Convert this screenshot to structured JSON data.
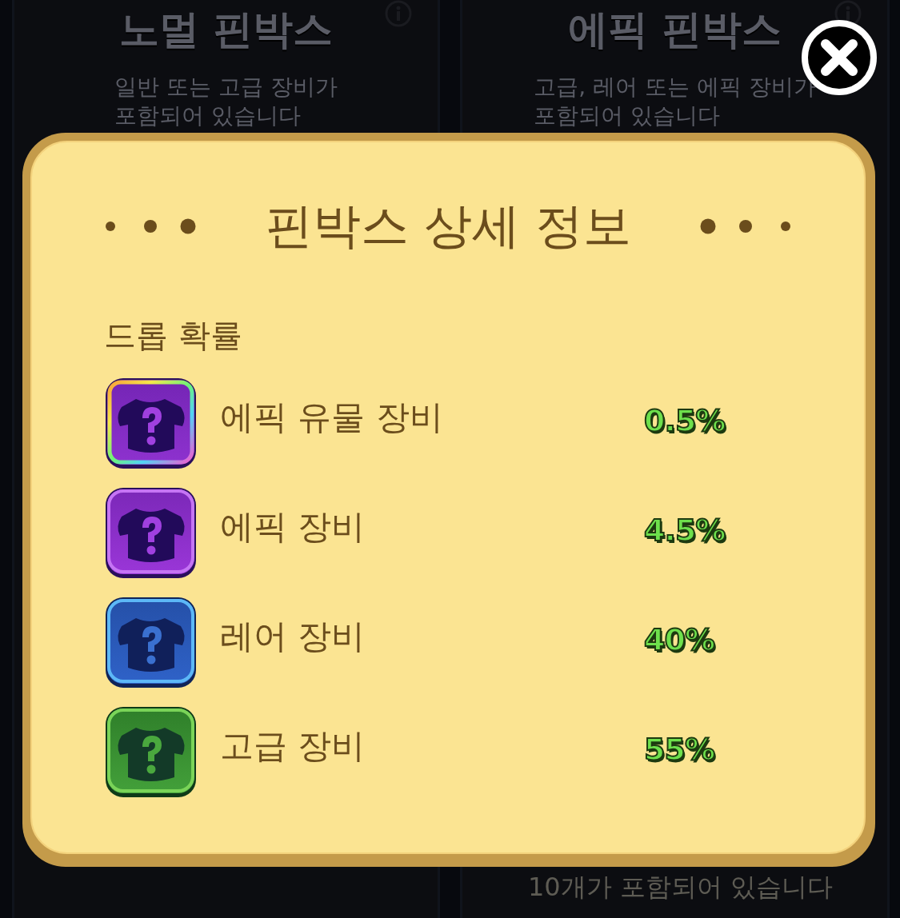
{
  "background_cards": [
    {
      "title": "노멀 핀박스",
      "description": [
        "일반 또는 고급 장비가",
        "포함되어 있습니다"
      ]
    },
    {
      "title": "에픽 핀박스",
      "description": [
        "고급, 레어 또는 에픽 장비가",
        "포함되어 있습니다"
      ]
    }
  ],
  "background_footer": "10개가 포함되어 있습니다",
  "dialog": {
    "title": "핀박스 상세 정보",
    "section_label": "드롭 확률",
    "items": [
      {
        "kind": "relic",
        "name": "에픽 유물 장비",
        "chance": "0.5%"
      },
      {
        "kind": "epic",
        "name": "에픽 장비",
        "chance": "4.5%"
      },
      {
        "kind": "rare",
        "name": "레어 장비",
        "chance": "40%"
      },
      {
        "kind": "common",
        "name": "고급 장비",
        "chance": "55%"
      }
    ]
  }
}
